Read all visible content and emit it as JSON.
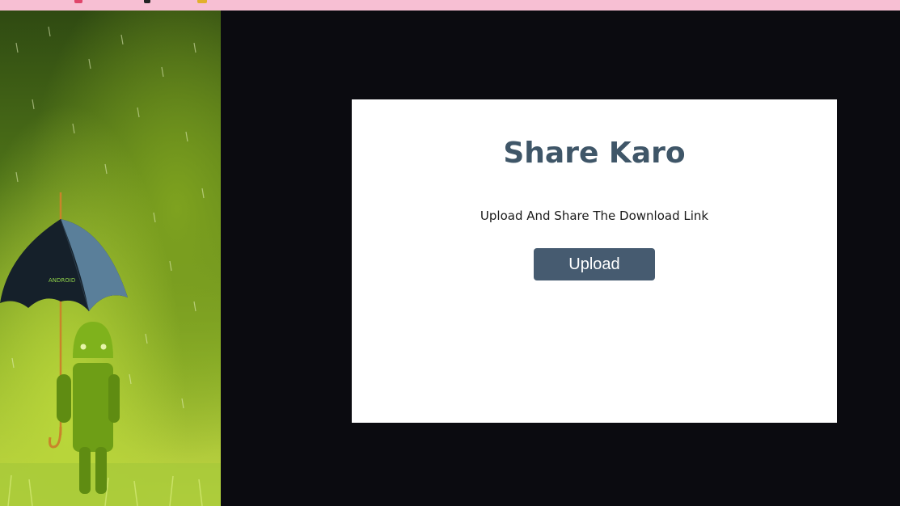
{
  "colors": {
    "top_bar": "#f7bfd3",
    "page_background": "#0b0b10",
    "card_background": "#ffffff",
    "title_color": "#3f5668",
    "button_background": "#465b70",
    "button_text": "#ffffff"
  },
  "hero": {
    "umbrella_text": "ANDROID"
  },
  "card": {
    "title": "Share Karo",
    "subtitle": "Upload And Share The Download Link",
    "upload_label": "Upload"
  }
}
